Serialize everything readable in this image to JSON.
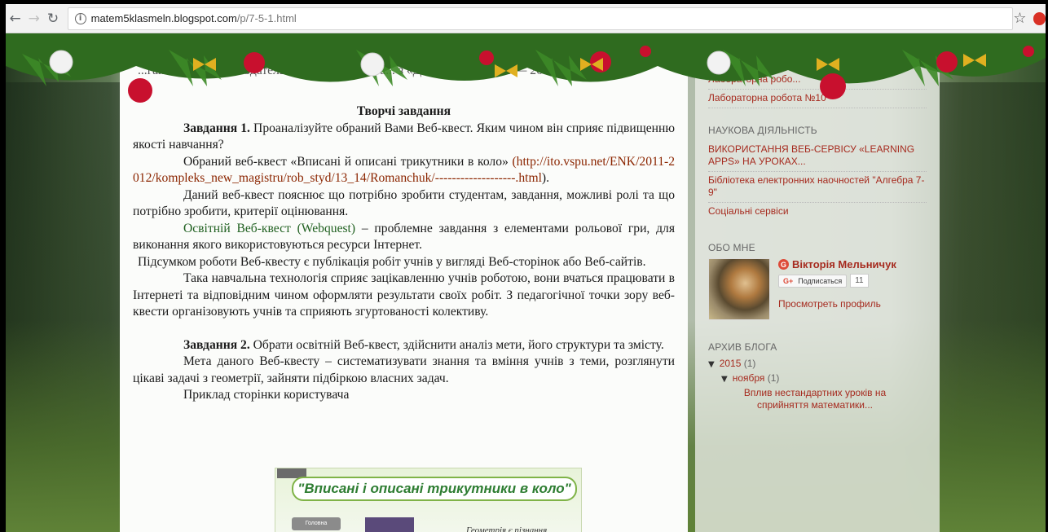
{
  "browser": {
    "url_host": "matem5klasmeln.blogspot.com",
    "url_path": "/p/7-5-1.html"
  },
  "content": {
    "header_faded": "...ганн — 2-е ... М.: Здательско-торгова... пора... з «Дашков и Ко», 2... — 260",
    "section_title": "Творчі завдання",
    "task1_label": "Завдання 1.",
    "task1_text": " Проаналізуйте обраний Вами Веб-квест. Яким чином він сприяє підвищенню якості навчання?",
    "p1_text": "Обраний веб-квест «Вписані й описані трикутники в коло» ",
    "p1_link": "(http://ito.vspu.net/ENK/2011-2012/kompleks_new_magistru/rob_styd/13_14/Romanchuk/-------------------.html",
    "p1_end": ").",
    "p2": "Даний веб-квест пояснює що потрібно зробити студентам, завдання, можливі ролі та що потрібно зробити, критерії оцінювання.",
    "p3_green": "Освітній Веб-квест (Webquest)",
    "p3_rest": " – проблемне завдання з елементами рольової гри, для виконання якого використовуються ресурси Інтернет.",
    "p4": "Підсумком роботи Веб-квесту є публікація робіт учнів у вигляді Веб-сторінок або Веб-сайтів.",
    "p5": "Така навчальна технологія сприяє зацікавленню учнів роботою, вони вчаться працювати в Інтернеті та відповідним чином оформляти результати своїх робіт. З педагогічної точки зору веб-квести організовують учнів та сприяють згуртованості колективу.",
    "task2_label": "Завдання 2.",
    "task2_text": " Обрати освітній Веб-квест, здійснити аналіз мети, його структури та змісту.",
    "p6": "Мета даного Веб-квесту – систематизувати знання та вміння учнів з теми, розглянути цікаві задачі з геометрії, зайняти підбіркою власних задач.",
    "p7": "Приклад сторінки користувача",
    "screenshot_title": "\"Вписані і описані трикутники в коло\"",
    "screenshot_btn": "Головна",
    "screenshot_caption": "Геометрія є пізнання"
  },
  "sidebar": {
    "top_links": [
      "Лабораторна робо...",
      "Лабораторна робота №10"
    ],
    "science_heading": "НАУКОВА ДІЯЛЬНІСТЬ",
    "science_links": [
      "ВИКОРИСТАННЯ ВЕБ-СЕРВІСУ «LEARNING APPS» НА УРОКАХ...",
      "Бібліотека електронних наочностей \"Алгебра 7-9\"",
      "Соціальні сервіси"
    ],
    "about_heading": "ОБО МНЕ",
    "profile_name": "Вікторія Мельничук",
    "follow_label": "Подписаться",
    "follow_count": "11",
    "profile_link": "Просмотреть профиль",
    "archive_heading": "АРХИВ БЛОГА",
    "archive_year": "2015",
    "archive_year_count": "(1)",
    "archive_month": "ноября",
    "archive_month_count": "(1)",
    "archive_post": "Вплив нестандартних уроків на сприйняття математики..."
  }
}
